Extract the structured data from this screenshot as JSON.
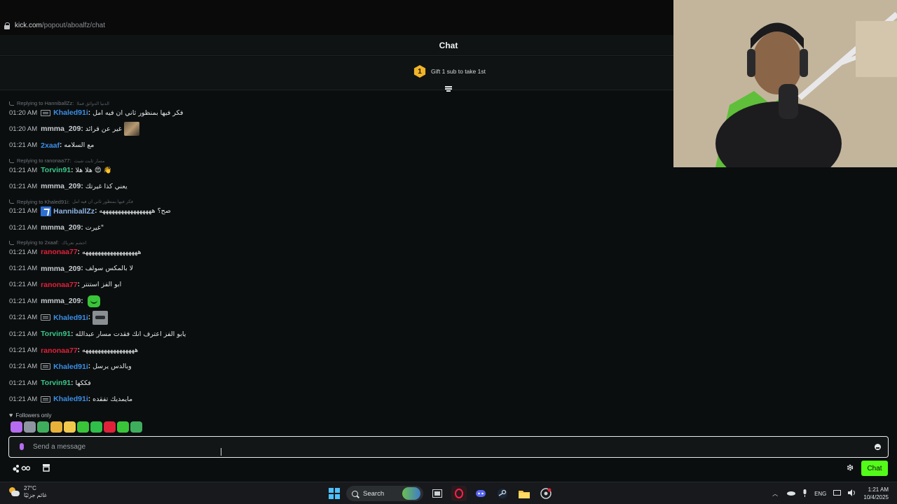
{
  "browser": {
    "url_domain": "kick.com",
    "url_path": "/popout/aboalfz/chat"
  },
  "chat": {
    "title": "Chat",
    "gift": {
      "rank": "1",
      "text": "Gift 1 sub to take 1st"
    },
    "followers_only": "Followers only",
    "input_placeholder": "Send a message",
    "send_label": "Chat"
  },
  "messages": [
    {
      "reply_to": "Replying to HanniballZz:",
      "reply_quote": "الدنيا الدوائق فملا",
      "time": "01:20 AM",
      "user": "Khaled91i",
      "color": "#3a8fe8",
      "badge": "badge",
      "text": "فكر فيها بمنظور ثاني ان فيه امل"
    },
    {
      "time": "01:20 AM",
      "user": "mmma_209",
      "color": "#c8ccd0",
      "text": "غير عن قرائد",
      "emote": "image"
    },
    {
      "time": "01:21 AM",
      "user": "2xaaf",
      "color": "#3a8fe8",
      "text": "مع السلامه"
    },
    {
      "reply_to": "Replying to ranonaa77:",
      "reply_quote": "مسار ثابت شبث",
      "time": "01:21 AM",
      "user": "Torvin91",
      "color": "#39c98a",
      "text": "هلا هلا 😍 👋"
    },
    {
      "time": "01:21 AM",
      "user": "mmma_209",
      "color": "#c8ccd0",
      "text": "يعني كذا غيرتك"
    },
    {
      "reply_to": "Replying to Khaled91i:",
      "reply_quote": "فكر فيها بمنظور ثاني ان فيه امل",
      "time": "01:21 AM",
      "user": "HanniballZz",
      "color": "#8fb6e8",
      "badge": "verified",
      "text": "صح؟ هههههههههههههههههه"
    },
    {
      "time": "01:21 AM",
      "user": "mmma_209",
      "color": "#c8ccd0",
      "text": "غيرت\""
    },
    {
      "reply_to": "Replying to 2xaaf:",
      "reply_quote": "احشم نعرباك",
      "time": "01:21 AM",
      "user": "ranonaa77",
      "color": "#e0213a",
      "text": "ههههههههههههههههههه"
    },
    {
      "time": "01:21 AM",
      "user": "mmma_209",
      "color": "#c8ccd0",
      "text": "لا بالمكس سولف"
    },
    {
      "time": "01:21 AM",
      "user": "ranonaa77",
      "color": "#e0213a",
      "text": "ابو الفز استنتر"
    },
    {
      "time": "01:21 AM",
      "user": "mmma_209",
      "color": "#c8ccd0",
      "text": "",
      "emote": "green"
    },
    {
      "time": "01:21 AM",
      "user": "Khaled91i",
      "color": "#3a8fe8",
      "badge": "badge",
      "text": "",
      "emote": "car"
    },
    {
      "time": "01:21 AM",
      "user": "Torvin91",
      "color": "#39c98a",
      "text": "يابو الفز اعترف انك فقدت مسار عبدالله"
    },
    {
      "time": "01:21 AM",
      "user": "ranonaa77",
      "color": "#e0213a",
      "text": "هههههههههههههههههه"
    },
    {
      "time": "01:21 AM",
      "user": "Khaled91i",
      "color": "#3a8fe8",
      "badge": "badge",
      "text": "وبالدس يرسل"
    },
    {
      "time": "01:21 AM",
      "user": "Torvin91",
      "color": "#39c98a",
      "text": "فككها"
    },
    {
      "time": "01:21 AM",
      "user": "Khaled91i",
      "color": "#3a8fe8",
      "badge": "badge",
      "text": "مايمديك تفقده"
    }
  ],
  "emote_bar": [
    "#b66cf0",
    "#8d96a0",
    "#3fae5c",
    "#e8b13a",
    "#f2c94c",
    "#39c43a",
    "#2fbf4a",
    "#e0213a",
    "#39c43a",
    "#3fae5c"
  ],
  "taskbar": {
    "weather_temp": "27°C",
    "weather_desc": "غائم جزئيًا",
    "search_label": "Search",
    "lang": "ENG",
    "time": "1:21 AM",
    "date": "10/4/2025"
  }
}
